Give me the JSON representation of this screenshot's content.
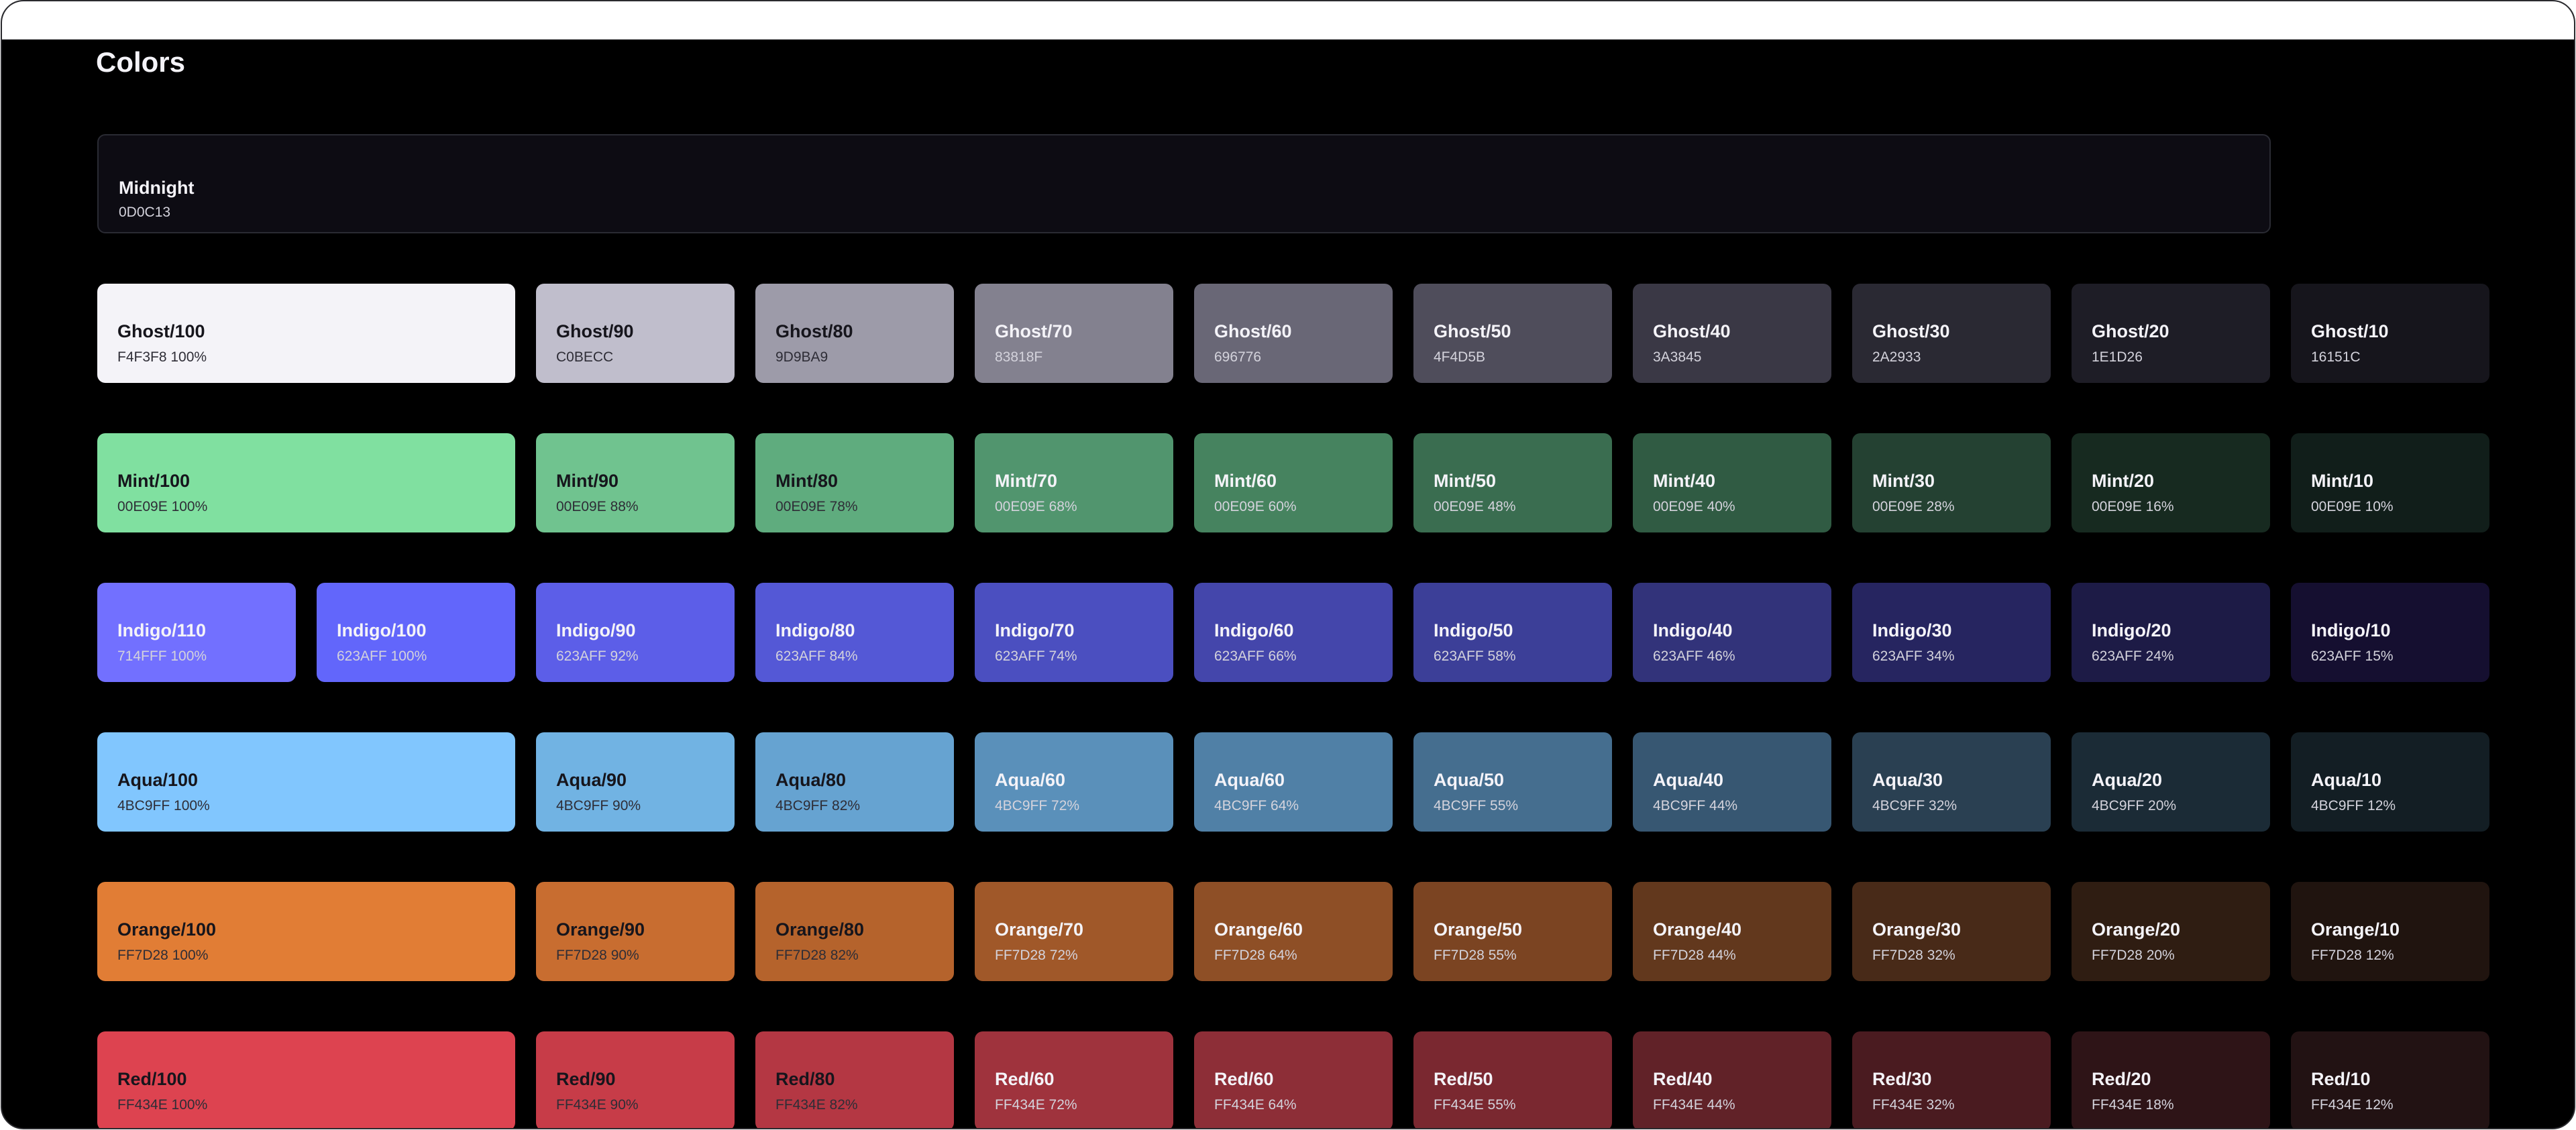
{
  "page": {
    "title": "Colors"
  },
  "midnight": {
    "name": "Midnight",
    "code": "0D0C13",
    "color": "#0d0c13"
  },
  "rows": [
    {
      "family": "Ghost",
      "swatches": [
        {
          "name": "Ghost/100",
          "code": "F4F3F8 100%",
          "color": "#f4f3f8",
          "text": "dark"
        },
        {
          "name": "Ghost/90",
          "code": "C0BECC",
          "color": "#c0becc",
          "text": "dark"
        },
        {
          "name": "Ghost/80",
          "code": "9D9BA9",
          "color": "#9d9ba9",
          "text": "dark"
        },
        {
          "name": "Ghost/70",
          "code": "83818F",
          "color": "#83818f",
          "text": "light"
        },
        {
          "name": "Ghost/60",
          "code": "696776",
          "color": "#696776",
          "text": "light"
        },
        {
          "name": "Ghost/50",
          "code": "4F4D5B",
          "color": "#4f4d5b",
          "text": "light"
        },
        {
          "name": "Ghost/40",
          "code": "3A3845",
          "color": "#3a3845",
          "text": "light"
        },
        {
          "name": "Ghost/30",
          "code": "2A2933",
          "color": "#2a2933",
          "text": "light"
        },
        {
          "name": "Ghost/20",
          "code": "1E1D26",
          "color": "#1e1d26",
          "text": "light"
        },
        {
          "name": "Ghost/10",
          "code": "16151C",
          "color": "#16151c",
          "text": "light"
        }
      ]
    },
    {
      "family": "Mint",
      "swatches": [
        {
          "name": "Mint/100",
          "code": "00E09E 100%",
          "color": "#80e0a0",
          "text": "dark"
        },
        {
          "name": "Mint/90",
          "code": "00E09E 88%",
          "color": "#70c38f",
          "text": "dark"
        },
        {
          "name": "Mint/80",
          "code": "00E09E 78%",
          "color": "#5fac7e",
          "text": "dark"
        },
        {
          "name": "Mint/70",
          "code": "00E09E 68%",
          "color": "#51956e",
          "text": "light"
        },
        {
          "name": "Mint/60",
          "code": "00E09E 60%",
          "color": "#46835f",
          "text": "light"
        },
        {
          "name": "Mint/50",
          "code": "00E09E 48%",
          "color": "#3a6d50",
          "text": "light"
        },
        {
          "name": "Mint/40",
          "code": "00E09E 40%",
          "color": "#305b43",
          "text": "light"
        },
        {
          "name": "Mint/30",
          "code": "00E09E 28%",
          "color": "#244132",
          "text": "light"
        },
        {
          "name": "Mint/20",
          "code": "00E09E 16%",
          "color": "#172a20",
          "text": "light"
        },
        {
          "name": "Mint/10",
          "code": "00E09E 10%",
          "color": "#111e1a",
          "text": "light"
        }
      ]
    },
    {
      "family": "Indigo",
      "swatches": [
        {
          "name": "Indigo/110",
          "code": "714FFF 100%",
          "color": "#7270ff",
          "text": "light"
        },
        {
          "name": "Indigo/100",
          "code": "623AFF 100%",
          "color": "#6266fb",
          "text": "light"
        },
        {
          "name": "Indigo/90",
          "code": "623AFF 92%",
          "color": "#5c5ee8",
          "text": "light"
        },
        {
          "name": "Indigo/80",
          "code": "623AFF 84%",
          "color": "#5458d6",
          "text": "light"
        },
        {
          "name": "Indigo/70",
          "code": "623AFF 74%",
          "color": "#4b4fc0",
          "text": "light"
        },
        {
          "name": "Indigo/60",
          "code": "623AFF 66%",
          "color": "#4446ab",
          "text": "light"
        },
        {
          "name": "Indigo/50",
          "code": "623AFF 58%",
          "color": "#3c3f98",
          "text": "light"
        },
        {
          "name": "Indigo/40",
          "code": "623AFF 46%",
          "color": "#32337a",
          "text": "light"
        },
        {
          "name": "Indigo/30",
          "code": "623AFF 34%",
          "color": "#262560",
          "text": "light"
        },
        {
          "name": "Indigo/20",
          "code": "623AFF 24%",
          "color": "#1d1b46",
          "text": "light"
        },
        {
          "name": "Indigo/10",
          "code": "623AFF 15%",
          "color": "#150f30",
          "text": "light"
        }
      ]
    },
    {
      "family": "Aqua",
      "swatches": [
        {
          "name": "Aqua/100",
          "code": "4BC9FF 100%",
          "color": "#81c6fe",
          "text": "dark"
        },
        {
          "name": "Aqua/90",
          "code": "4BC9FF 90%",
          "color": "#71b3e3",
          "text": "dark"
        },
        {
          "name": "Aqua/80",
          "code": "4BC9FF 82%",
          "color": "#66a3d1",
          "text": "dark"
        },
        {
          "name": "Aqua/60",
          "code": "4BC9FF 72%",
          "color": "#5a90ba",
          "text": "light"
        },
        {
          "name": "Aqua/60",
          "code": "4BC9FF 64%",
          "color": "#5080a6",
          "text": "light"
        },
        {
          "name": "Aqua/50",
          "code": "4BC9FF 55%",
          "color": "#456e8f",
          "text": "light"
        },
        {
          "name": "Aqua/40",
          "code": "4BC9FF 44%",
          "color": "#375772",
          "text": "light"
        },
        {
          "name": "Aqua/30",
          "code": "4BC9FF 32%",
          "color": "#2a4052",
          "text": "light"
        },
        {
          "name": "Aqua/20",
          "code": "4BC9FF 20%",
          "color": "#1b2b36",
          "text": "light"
        },
        {
          "name": "Aqua/10",
          "code": "4BC9FF 12%",
          "color": "#131e24",
          "text": "light"
        }
      ]
    },
    {
      "family": "Orange",
      "swatches": [
        {
          "name": "Orange/100",
          "code": "FF7D28 100%",
          "color": "#e17d35",
          "text": "dark"
        },
        {
          "name": "Orange/90",
          "code": "FF7D28 90%",
          "color": "#c86d30",
          "text": "dark"
        },
        {
          "name": "Orange/80",
          "code": "FF7D28 82%",
          "color": "#b5632c",
          "text": "dark"
        },
        {
          "name": "Orange/70",
          "code": "FF7D28 72%",
          "color": "#a05829",
          "text": "light"
        },
        {
          "name": "Orange/60",
          "code": "FF7D28 64%",
          "color": "#8e4f26",
          "text": "light"
        },
        {
          "name": "Orange/50",
          "code": "FF7D28 55%",
          "color": "#7b4422",
          "text": "light"
        },
        {
          "name": "Orange/40",
          "code": "FF7D28 44%",
          "color": "#62381d",
          "text": "light"
        },
        {
          "name": "Orange/30",
          "code": "FF7D28 32%",
          "color": "#482a18",
          "text": "light"
        },
        {
          "name": "Orange/20",
          "code": "FF7D28 20%",
          "color": "#2f1d12",
          "text": "light"
        },
        {
          "name": "Orange/10",
          "code": "FF7D28 12%",
          "color": "#20140f",
          "text": "light"
        }
      ]
    },
    {
      "family": "Red",
      "swatches": [
        {
          "name": "Red/100",
          "code": "FF434E 100%",
          "color": "#dd4350",
          "text": "dark"
        },
        {
          "name": "Red/90",
          "code": "FF434E 90%",
          "color": "#c73c48",
          "text": "dark"
        },
        {
          "name": "Red/80",
          "code": "FF434E 82%",
          "color": "#b43743",
          "text": "dark"
        },
        {
          "name": "Red/60",
          "code": "FF434E 72%",
          "color": "#9f333d",
          "text": "light"
        },
        {
          "name": "Red/60",
          "code": "FF434E 64%",
          "color": "#8d2e37",
          "text": "light"
        },
        {
          "name": "Red/50",
          "code": "FF434E 55%",
          "color": "#7a2830",
          "text": "light"
        },
        {
          "name": "Red/40",
          "code": "FF434E 44%",
          "color": "#612228",
          "text": "light"
        },
        {
          "name": "Red/30",
          "code": "FF434E 32%",
          "color": "#4a1b20",
          "text": "light"
        },
        {
          "name": "Red/20",
          "code": "FF434E 18%",
          "color": "#2e1417",
          "text": "light"
        },
        {
          "name": "Red/10",
          "code": "FF434E 12%",
          "color": "#221213",
          "text": "light"
        }
      ]
    }
  ],
  "text_colors": {
    "dark": "#16151c",
    "light": "#f4f3f8",
    "dark_code": "#2e2d36",
    "light_code": "#d4d3dc"
  }
}
